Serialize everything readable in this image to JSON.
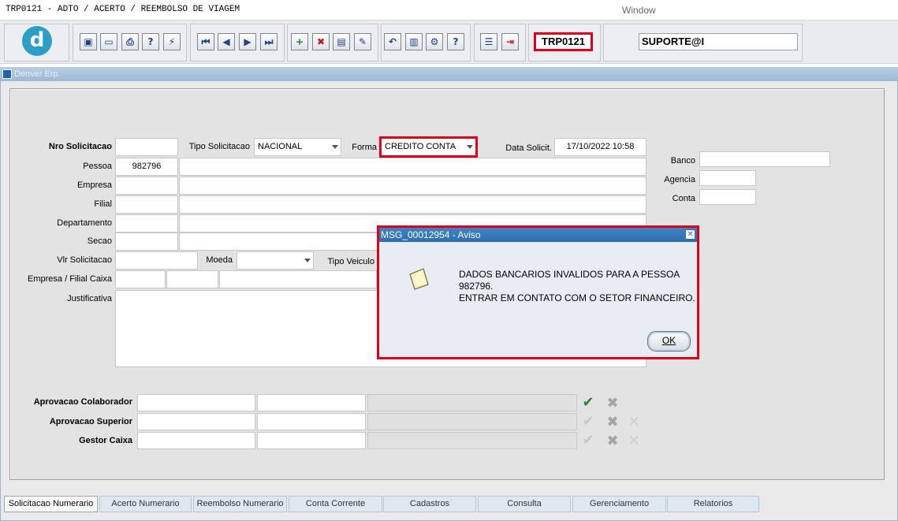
{
  "window": {
    "title": "TRP0121 - ADTO / ACERTO / REEMBOLSO DE VIAGEM",
    "menu": "Window"
  },
  "toolbar": {
    "form_code": "TRP0121",
    "user": "SUPORTE@I",
    "buttons": [
      {
        "name": "save-icon",
        "glyph": "▣"
      },
      {
        "name": "window-icon",
        "glyph": "▭"
      },
      {
        "name": "print-icon",
        "glyph": "⎙"
      },
      {
        "name": "query-icon",
        "glyph": "?"
      },
      {
        "name": "execute-icon",
        "glyph": "⚡"
      },
      {
        "name": "first-record-icon",
        "glyph": "⏮"
      },
      {
        "name": "prev-record-icon",
        "glyph": "◀"
      },
      {
        "name": "next-record-icon",
        "glyph": "▶"
      },
      {
        "name": "last-record-icon",
        "glyph": "⏭"
      },
      {
        "name": "insert-icon",
        "glyph": "+"
      },
      {
        "name": "delete-icon",
        "glyph": "✖"
      },
      {
        "name": "duplicate-icon",
        "glyph": "▤"
      },
      {
        "name": "clear-icon",
        "glyph": "✎"
      },
      {
        "name": "undo-icon",
        "glyph": "↶"
      },
      {
        "name": "clipboard-icon",
        "glyph": "▥"
      },
      {
        "name": "tools-icon",
        "glyph": "⚙"
      },
      {
        "name": "help-icon",
        "glyph": "?"
      },
      {
        "name": "menu-icon",
        "glyph": "☰"
      },
      {
        "name": "exit-icon",
        "glyph": "⇥"
      }
    ]
  },
  "frame": {
    "title": "Denver Erp"
  },
  "form": {
    "nro_solicitacao_label": "Nro Solicitacao",
    "tipo_solicitacao_label": "Tipo Solicitacao",
    "tipo_solicitacao_value": "NACIONAL",
    "forma_label": "Forma",
    "forma_value": "CREDITO CONTA",
    "data_solicit_label": "Data Solicit.",
    "data_solicit_value": "17/10/2022 10:58",
    "pessoa_label": "Pessoa",
    "pessoa_value": "982796",
    "empresa_label": "Empresa",
    "filial_label": "Filial",
    "departamento_label": "Departamento",
    "secao_label": "Secao",
    "vlr_solicitacao_label": "Vlr Solicitacao",
    "moeda_label": "Moeda",
    "tipo_veiculo_label": "Tipo Veiculo",
    "empresa_filial_caixa_label": "Empresa / Filial Caixa",
    "justificativa_label": "Justificativa",
    "banco_label": "Banco",
    "agencia_label": "Agencia",
    "conta_label": "Conta",
    "aprovacao_colaborador_label": "Aprovacao Colaborador",
    "aprovacao_superior_label": "Aprovacao Superior",
    "gestor_caixa_label": "Gestor Caixa"
  },
  "dialog": {
    "title": "MSG_00012954 - Aviso",
    "line1": "DADOS BANCARIOS INVALIDOS PARA A PESSOA",
    "line2": "982796.",
    "line3": "ENTRAR EM CONTATO COM O SETOR FINANCEIRO.",
    "ok_label": "OK"
  },
  "tabs": [
    {
      "label": "Solicitacao Numerario",
      "active": true
    },
    {
      "label": "Acerto Numerario"
    },
    {
      "label": "Reembolso Numerario"
    },
    {
      "label": "Conta Corrente"
    },
    {
      "label": "Cadastros"
    },
    {
      "label": "Consulta"
    },
    {
      "label": "Gerenciamento"
    },
    {
      "label": "Relatorios"
    }
  ],
  "colors": {
    "highlight": "#e0001b",
    "dialog_header": "#2d6eae",
    "approve_check": "#1e8d2a"
  }
}
